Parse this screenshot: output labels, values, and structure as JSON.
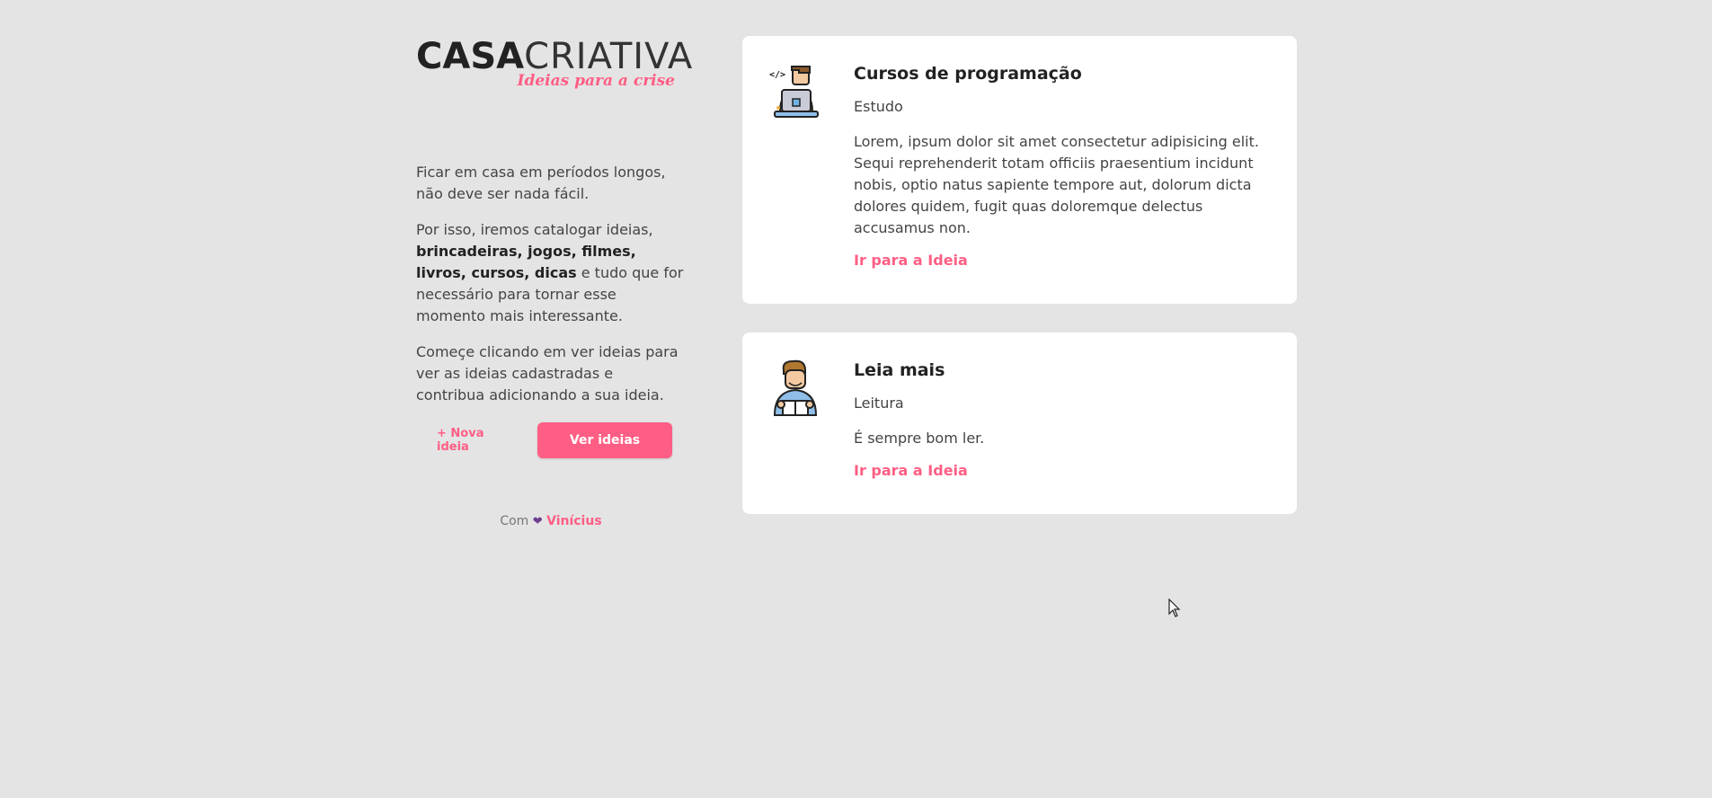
{
  "logo": {
    "word1": "CASA",
    "word2": "CRIATIVA",
    "tagline": "Ideias para a crise"
  },
  "intro": {
    "p1": "Ficar em casa em períodos longos, não deve ser nada fácil.",
    "p2_start": "Por isso, iremos catalogar ideias,",
    "p2_bold": "brincadeiras, jogos, filmes, livros, cursos, dicas",
    "p2_end": "e tudo que for necessário para tornar esse momento mais interessante.",
    "p3": "Começe clicando em ver ideias para ver as ideias cadastradas e contribua adicionando a sua ideia."
  },
  "buttons": {
    "new_idea": "+ Nova ideia",
    "see_ideas": "Ver ideias"
  },
  "credit": {
    "prefix": "Com",
    "author": "Vinícius"
  },
  "ideas": [
    {
      "title": "Cursos de programação",
      "category": "Estudo",
      "description": "Lorem, ipsum dolor sit amet consectetur adipisicing elit. Sequi reprehenderit totam officiis praesentium incidunt nobis, optio natus sapiente tempore aut, dolorum dicta dolores quidem, fugit quas doloremque delectus accusamus non.",
      "link": "Ir para a Ideia",
      "icon": "programmer-icon"
    },
    {
      "title": "Leia mais",
      "category": "Leitura",
      "description": "É sempre bom ler.",
      "link": "Ir para a Ideia",
      "icon": "reader-icon"
    }
  ],
  "colors": {
    "accent": "#ff5e84",
    "background": "#e4e4e4",
    "card": "#ffffff"
  }
}
